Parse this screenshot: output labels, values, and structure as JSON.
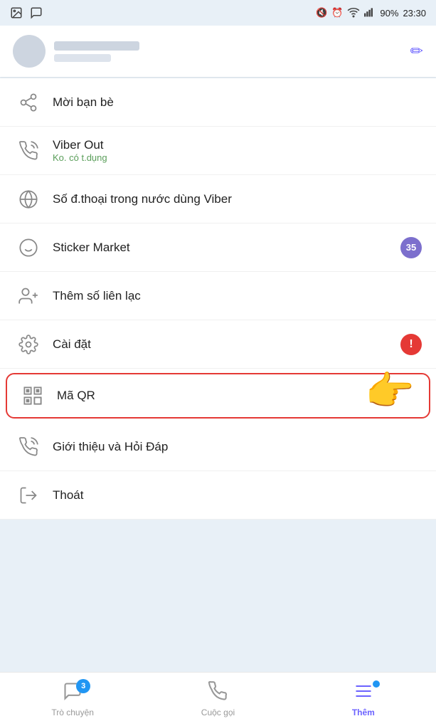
{
  "statusBar": {
    "time": "23:30",
    "battery": "90%",
    "signal": "●●●"
  },
  "header": {
    "editIconLabel": "✏"
  },
  "menuItems": [
    {
      "id": "invite",
      "label": "Mời bạn bè",
      "iconType": "share",
      "badge": null
    },
    {
      "id": "viber-out",
      "label": "Viber Out",
      "sublabel": "Ko. có t.dụng",
      "iconType": "phone-plus",
      "badge": null
    },
    {
      "id": "phone-numbers",
      "label": "Số đ.thoại trong nước dùng Viber",
      "iconType": "globe",
      "badge": null
    },
    {
      "id": "sticker-market",
      "label": "Sticker Market",
      "iconType": "sticker",
      "badge": "35"
    },
    {
      "id": "add-contact",
      "label": "Thêm số liên lạc",
      "iconType": "add-person",
      "badge": null
    },
    {
      "id": "settings",
      "label": "Cài đặt",
      "iconType": "settings",
      "badge": "!"
    },
    {
      "id": "qr",
      "label": "Mã QR",
      "iconType": "qr",
      "badge": null,
      "highlighted": true
    },
    {
      "id": "intro",
      "label": "Giới thiệu và Hỏi Đáp",
      "iconType": "viber",
      "badge": null
    },
    {
      "id": "logout",
      "label": "Thoát",
      "iconType": "logout",
      "badge": null
    }
  ],
  "bottomNav": [
    {
      "id": "chat",
      "label": "Trò chuyện",
      "iconType": "chat",
      "badge": "3",
      "active": false
    },
    {
      "id": "calls",
      "label": "Cuộc gọi",
      "iconType": "phone",
      "badge": null,
      "active": false
    },
    {
      "id": "more",
      "label": "Thêm",
      "iconType": "menu",
      "badge": "dot",
      "active": true
    }
  ]
}
